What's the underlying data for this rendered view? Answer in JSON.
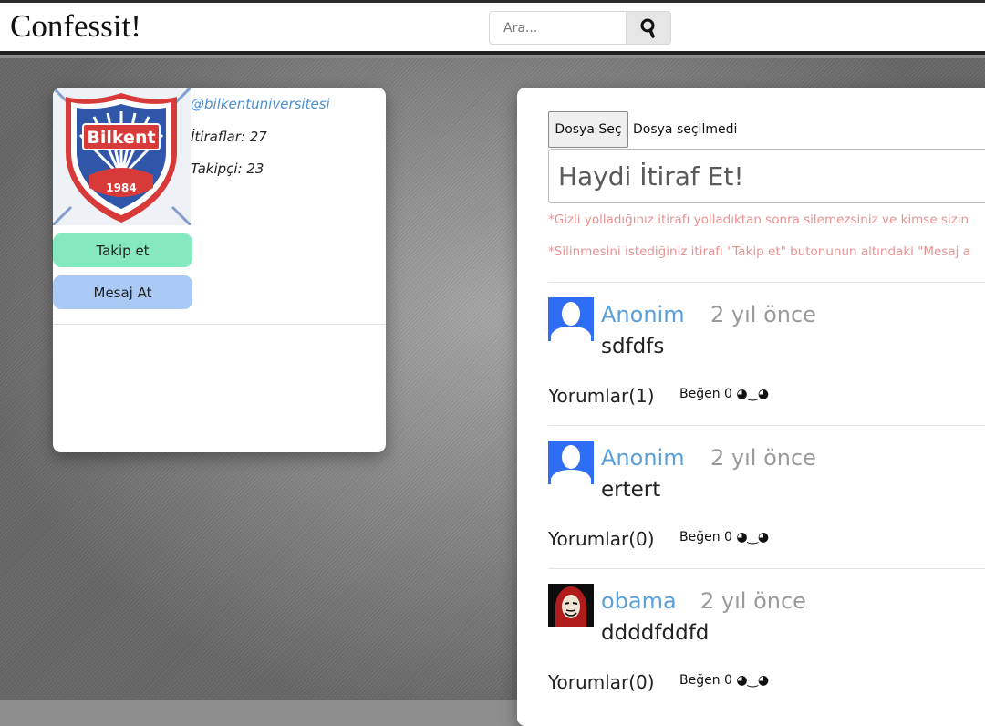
{
  "app": {
    "brand": "Confessit!"
  },
  "search": {
    "placeholder": "Ara..."
  },
  "profile": {
    "handle": "@bilkentuniversitesi",
    "confessions_label": "İtiraflar: 27",
    "followers_label": "Takipçi: 23",
    "logo_text": "Bilkent",
    "logo_year": "1984",
    "follow_button": "Takip et",
    "message_button": "Mesaj At"
  },
  "composer": {
    "file_button": "Dosya Seç",
    "file_status": "Dosya seçilmedi",
    "placeholder": "Haydi İtiraf Et!",
    "note1": "*Gizli yolladığınız itirafı yolladıktan sonra silemezsiniz ve kimse sizin",
    "note2": "*Silinmesini istediğiniz itirafı \"Takip et\" butonunun altındaki \"Mesaj a"
  },
  "posts": [
    {
      "user": "Anonim",
      "time": "2 yıl önce",
      "text": "sdfdfs",
      "comments": "Yorumlar(1)",
      "like": "Beğen 0 ◕‿◕",
      "avatar": "default-user-icon"
    },
    {
      "user": "Anonim",
      "time": "2 yıl önce",
      "text": "ertert",
      "comments": "Yorumlar(0)",
      "like": "Beğen 0 ◕‿◕",
      "avatar": "default-user-icon"
    },
    {
      "user": "obama",
      "time": "2 yıl önce",
      "text": "ddddfddfd",
      "comments": "Yorumlar(0)",
      "like": "Beğen 0 ◕‿◕",
      "avatar": "mask-avatar"
    }
  ],
  "colors": {
    "accent_link": "#5b9fd8",
    "follow_button": "#85e8bf",
    "message_button": "#aacaf5",
    "warning_note": "#e89292",
    "avatar_blue": "#2f6df5"
  }
}
